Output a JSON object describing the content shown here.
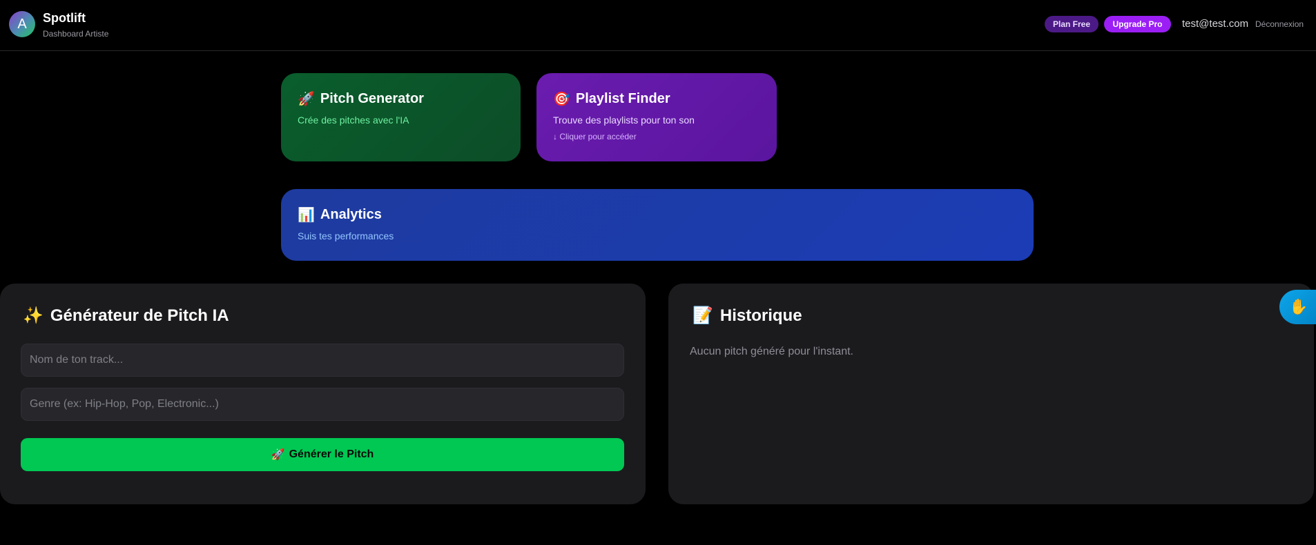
{
  "header": {
    "brand_name": "Spotlift",
    "brand_subtitle": "Dashboard Artiste",
    "avatar_glyph": "A",
    "plan_label": "Plan Free",
    "upgrade_label": "Upgrade Pro",
    "user_email": "test@test.com",
    "logout_label": "Déconnexion"
  },
  "cards": {
    "pitch": {
      "icon": "🚀",
      "title": "Pitch Generator",
      "subtitle": "Crée des pitches avec l'IA"
    },
    "playlist": {
      "icon": "🎯",
      "title": "Playlist Finder",
      "subtitle": "Trouve des playlists pour ton son",
      "hint": "↓ Cliquer pour accéder"
    },
    "analytics": {
      "icon": "📊",
      "title": "Analytics",
      "subtitle": "Suis tes performances"
    }
  },
  "generator": {
    "icon": "✨",
    "title": "Générateur de Pitch IA",
    "track_placeholder": "Nom de ton track...",
    "genre_placeholder": "Genre (ex: Hip-Hop, Pop, Electronic...)",
    "button_icon": "🚀",
    "button_label": "Générer le Pitch"
  },
  "history": {
    "icon": "📝",
    "title": "Historique",
    "empty_text": "Aucun pitch généré pour l'instant."
  },
  "colors": {
    "background": "#000000",
    "panel": "#1b1b1e",
    "accent_green": "#00c853",
    "accent_purple": "#9b1ff5",
    "analytics_blue": "#1b3cb5"
  }
}
